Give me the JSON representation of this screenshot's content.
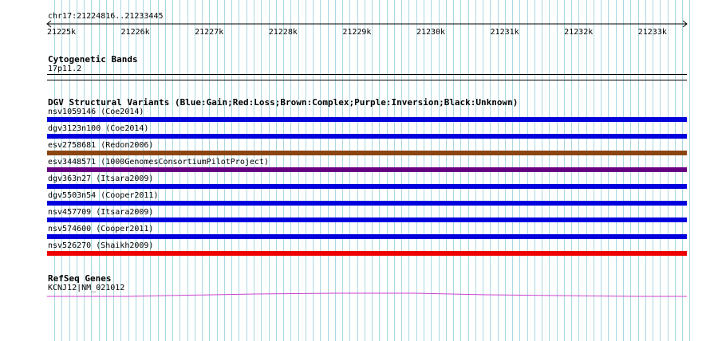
{
  "browser": {
    "region": "chr17:21224816..21233445",
    "ruler_ticks": [
      "21225k",
      "21226k",
      "21227k",
      "21228k",
      "21229k",
      "21230k",
      "21231k",
      "21232k",
      "21233k"
    ]
  },
  "tracks": {
    "cytogenetic": {
      "title": "Cytogenetic Bands",
      "band": "17p11.2"
    },
    "dgv": {
      "title": "DGV Structural Variants (Blue:Gain;Red:Loss;Brown:Complex;Purple:Inversion;Black:Unknown)",
      "features": [
        {
          "label": "nsv1059146 (Coe2014)",
          "color": "#0000dd"
        },
        {
          "label": "dgv3123n100 (Coe2014)",
          "color": "#0000dd"
        },
        {
          "label": "esv2758681 (Redon2006)",
          "color": "#8b4513"
        },
        {
          "label": "esv3448571 (1000GenomesConsortiumPilotProject)",
          "color": "#660080"
        },
        {
          "label": "dgv363n27 (Itsara2009)",
          "color": "#0000dd"
        },
        {
          "label": "dgv5503n54 (Cooper2011)",
          "color": "#0000dd"
        },
        {
          "label": "nsv457709 (Itsara2009)",
          "color": "#0000dd"
        },
        {
          "label": "nsv574600 (Cooper2011)",
          "color": "#0000dd"
        },
        {
          "label": "nsv526270 (Shaikh2009)",
          "color": "#ee0000"
        }
      ]
    },
    "refseq": {
      "title": "RefSeq Genes",
      "gene": "KCNJ12|NM_021012",
      "color": "#cc44cc"
    }
  }
}
